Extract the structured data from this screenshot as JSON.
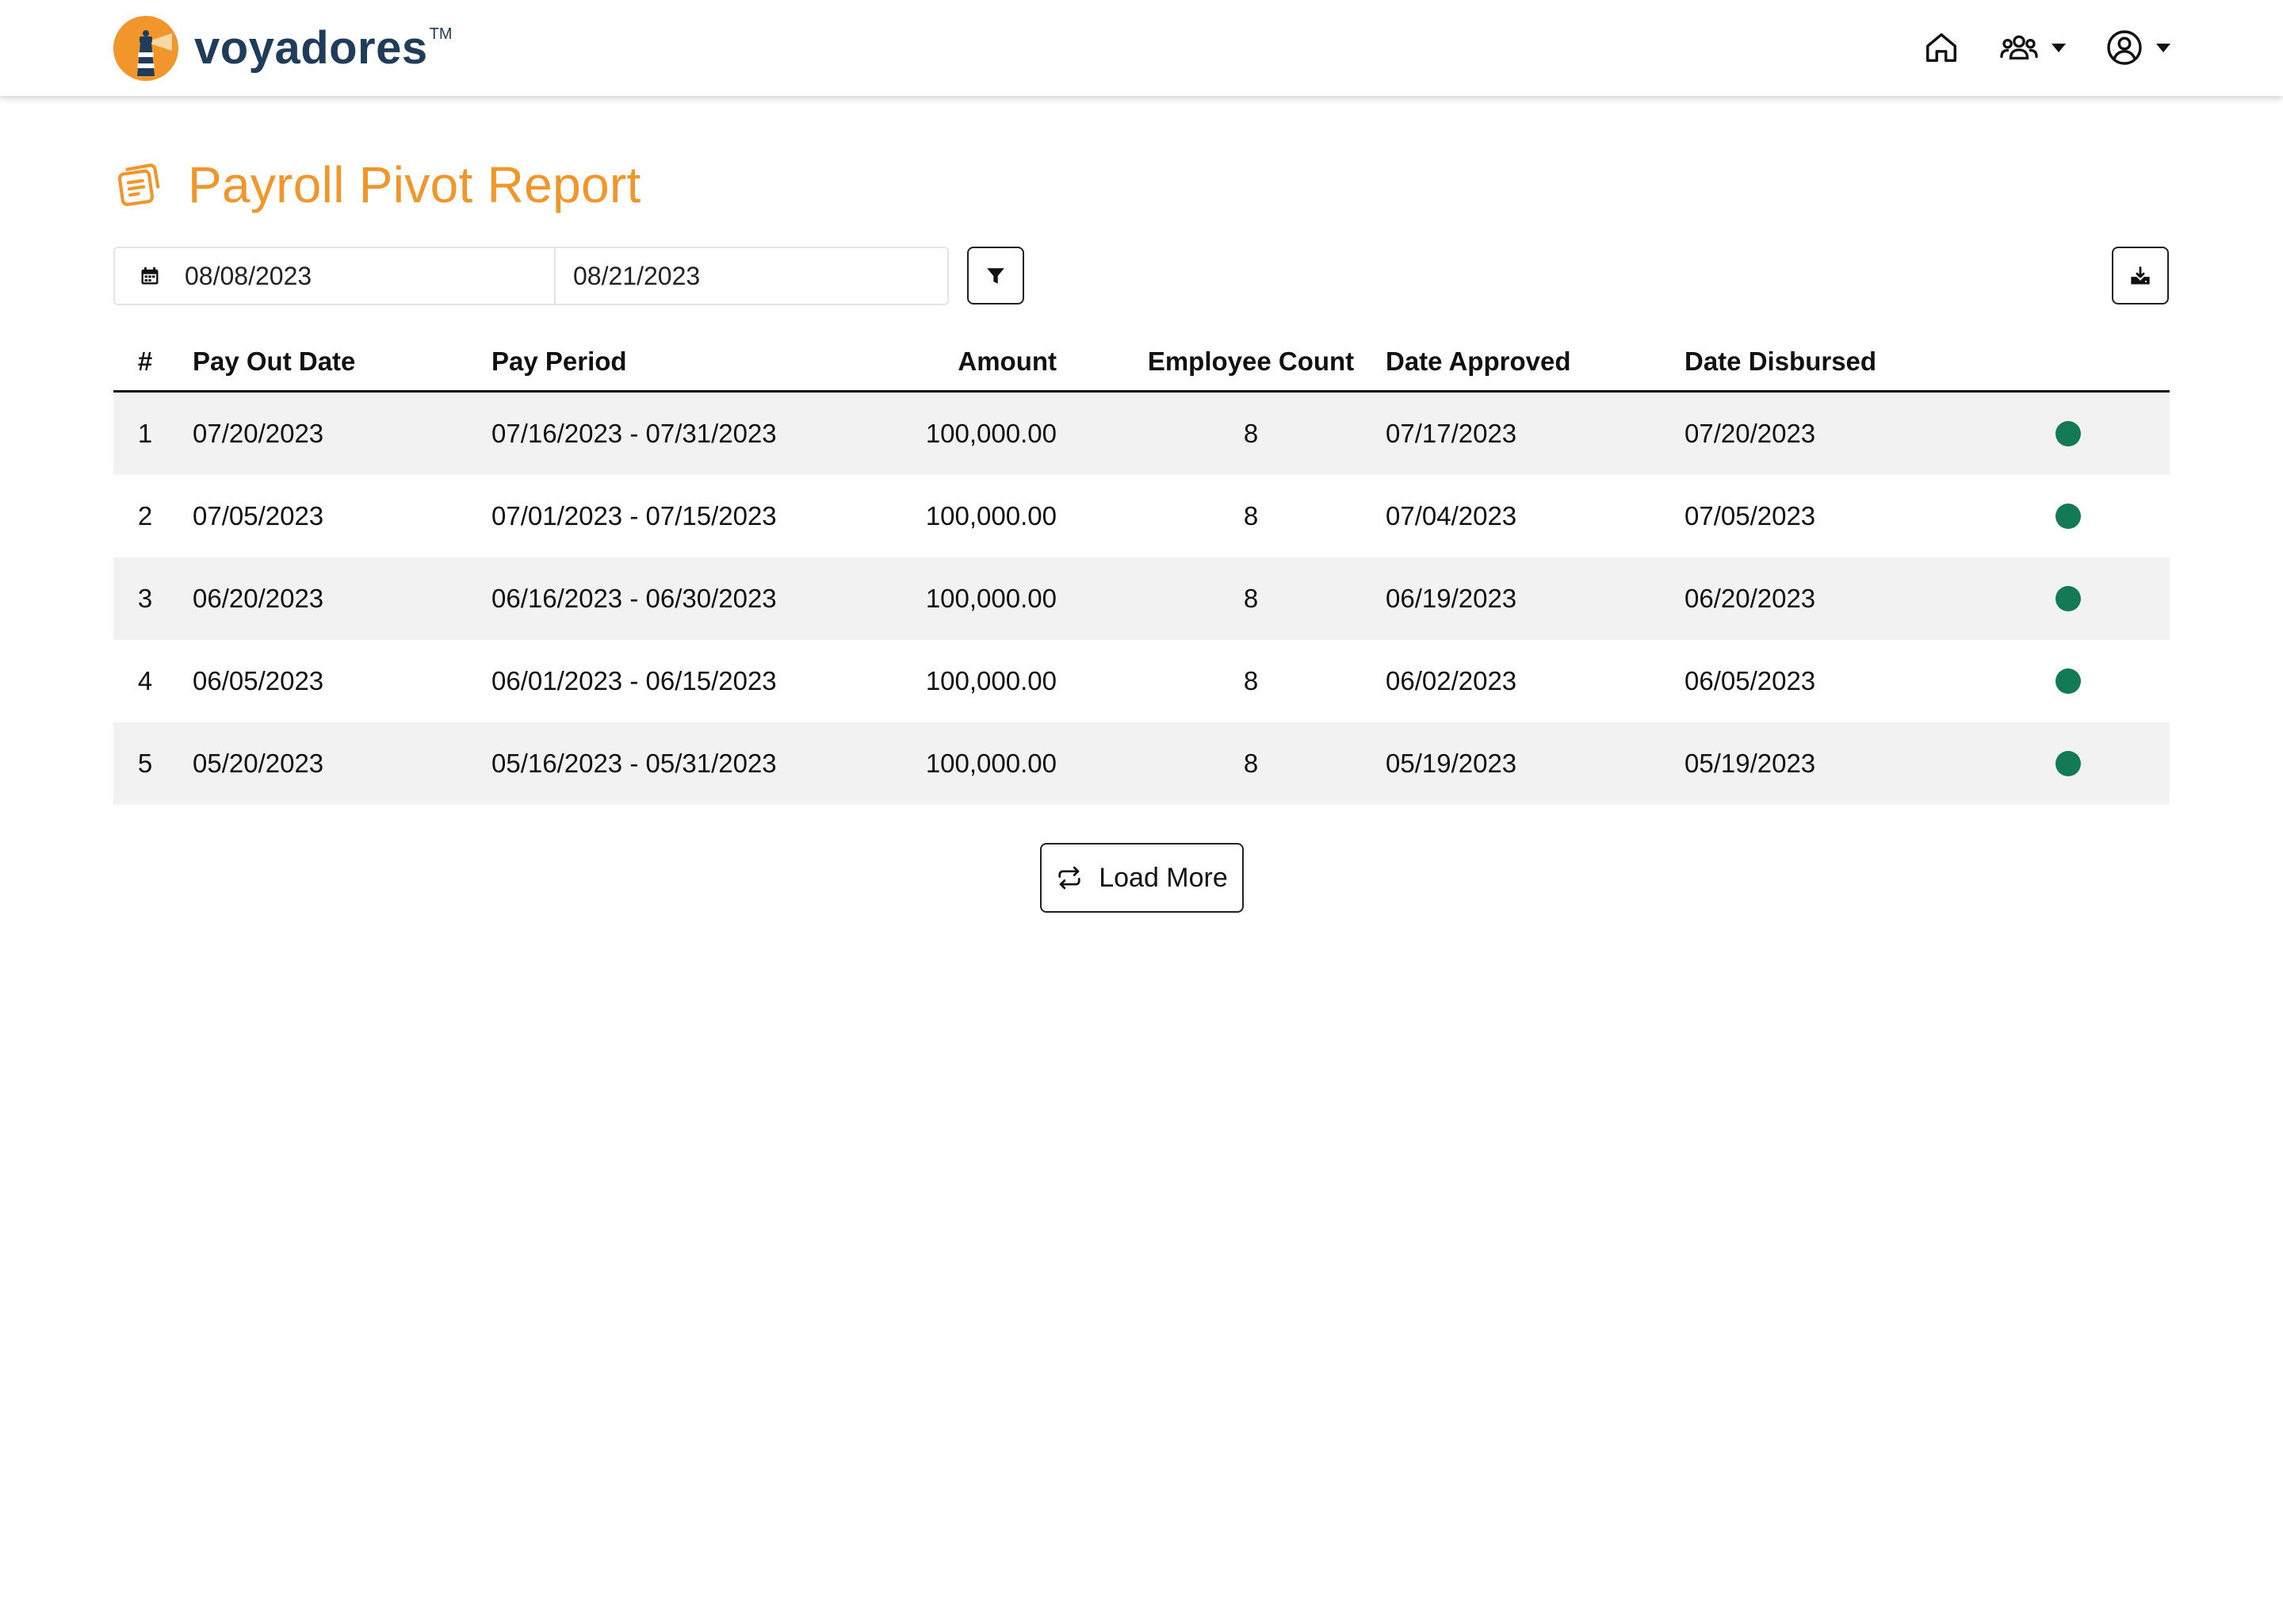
{
  "brand": {
    "name": "voyadores",
    "tm": "TM"
  },
  "colors": {
    "accent": "#f0962a",
    "brand_navy": "#1f3d5a",
    "status_ok": "#147a55",
    "row_alt": "#f2f2f2"
  },
  "header": {
    "icons": [
      "home-icon",
      "users-icon",
      "chevron-down-icon",
      "account-icon",
      "chevron-down-icon"
    ]
  },
  "page": {
    "title": "Payroll Pivot Report",
    "title_icon": "notes-icon"
  },
  "filters": {
    "start_date": "08/08/2023",
    "end_date": "08/21/2023",
    "calendar_icon": "calendar-icon",
    "filter_icon": "filter-icon",
    "download_icon": "download-icon"
  },
  "table": {
    "columns": [
      "#",
      "Pay Out Date",
      "Pay Period",
      "Amount",
      "Employee Count",
      "Date Approved",
      "Date Disbursed"
    ],
    "rows": [
      {
        "num": "1",
        "payout": "07/20/2023",
        "period": "07/16/2023 - 07/31/2023",
        "amount": "100,000.00",
        "count": "8",
        "approved": "07/17/2023",
        "disbursed": "07/20/2023",
        "status": "complete"
      },
      {
        "num": "2",
        "payout": "07/05/2023",
        "period": "07/01/2023 - 07/15/2023",
        "amount": "100,000.00",
        "count": "8",
        "approved": "07/04/2023",
        "disbursed": "07/05/2023",
        "status": "complete"
      },
      {
        "num": "3",
        "payout": "06/20/2023",
        "period": "06/16/2023 - 06/30/2023",
        "amount": "100,000.00",
        "count": "8",
        "approved": "06/19/2023",
        "disbursed": "06/20/2023",
        "status": "complete"
      },
      {
        "num": "4",
        "payout": "06/05/2023",
        "period": "06/01/2023 - 06/15/2023",
        "amount": "100,000.00",
        "count": "8",
        "approved": "06/02/2023",
        "disbursed": "06/05/2023",
        "status": "complete"
      },
      {
        "num": "5",
        "payout": "05/20/2023",
        "period": "05/16/2023 - 05/31/2023",
        "amount": "100,000.00",
        "count": "8",
        "approved": "05/19/2023",
        "disbursed": "05/19/2023",
        "status": "complete"
      }
    ]
  },
  "load_more": {
    "label": "Load More",
    "icon": "repeat-icon"
  }
}
